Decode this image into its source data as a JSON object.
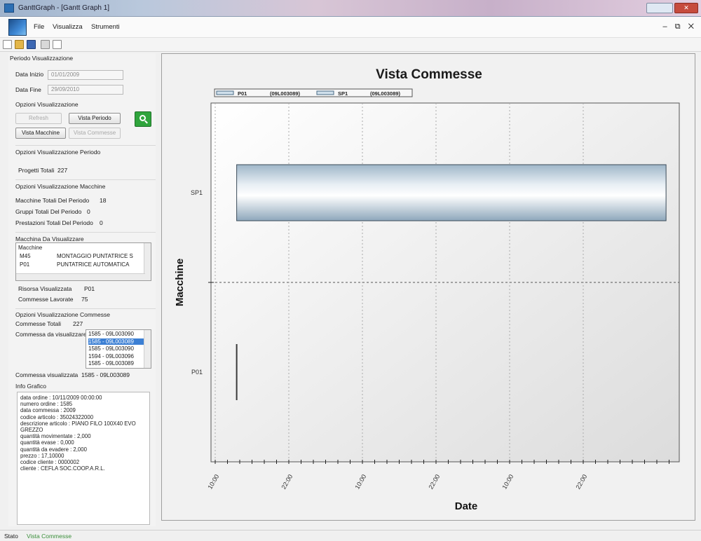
{
  "window": {
    "title": "GanttGraph - [Gantt Graph 1]"
  },
  "menu": [
    "File",
    "Visualizza",
    "Strumenti"
  ],
  "periodo": {
    "header": "Periodo Visualizzazione",
    "data_inizio_label": "Data Inizio",
    "data_inizio_value": "01/01/2009",
    "data_fine_label": "Data Fine",
    "data_fine_value": "29/09/2010"
  },
  "opzioni": {
    "header": "Opzioni Visualizzazione",
    "refresh": "Refresh",
    "vista_periodo": "Vista Periodo",
    "vista_macchine": "Vista Macchine",
    "vista_commesse": "Vista Commesse"
  },
  "periodo_opts": {
    "header": "Opzioni Visualizzazione Periodo",
    "progetti_label": "Progetti Totali",
    "progetti_value": "227"
  },
  "macchine_opts": {
    "header": "Opzioni Visualizzazione Macchine",
    "macchine_totali_label": "Macchine Totali Del Periodo",
    "macchine_totali_value": "18",
    "gruppi_label": "Gruppi Totali Del Periodo",
    "gruppi_value": "0",
    "prestazioni_label": "Prestazioni Totali Del Periodo",
    "prestazioni_value": "0"
  },
  "macchina_da_visualizzare": {
    "header": "Macchina Da Visualizzare",
    "list_header": "Macchine",
    "rows": [
      {
        "code": "M45",
        "desc": "MONTAGGIO PUNTATRICE S"
      },
      {
        "code": "P01",
        "desc": "PUNTATRICE AUTOMATICA"
      }
    ],
    "risorsa_label": "Risorsa Visualizzata",
    "risorsa_value": "P01",
    "commesse_lavorate_label": "Commesse Lavorate",
    "commesse_lavorate_value": "75"
  },
  "commesse_opts": {
    "header": "Opzioni Visualizzazione Commesse",
    "totali_label": "Commesse Totali",
    "totali_value": "227",
    "da_visualizzare_label": "Commessa da visualizzare",
    "list": [
      "1585 - 09L003090",
      "1585 - 09L003089",
      "1585 - 09L003090",
      "1594 - 09L003096",
      "1585 - 09L003089"
    ],
    "selected_index": 1,
    "visualizzata_label": "Commessa visualizzata",
    "visualizzata_value": "1585 - 09L003089"
  },
  "info_grafico": {
    "header": "Info Grafico",
    "lines": [
      "data ordine : 10/11/2009 00:00:00",
      "numero ordine : 1585",
      "data commessa : 2009",
      "codice articolo : 35024322000",
      "descrizione articolo : PIANO FILO 100X40 EVO GREZZO",
      "quantità movimentate : 2,000",
      "quantità evase : 0,000",
      "quantità da evadere : 2,000",
      "prezzo : 17,10000",
      "codice cliente : 0000002",
      "cliente : CEFLA SOC.COOP.A.R.L."
    ]
  },
  "chart_data": {
    "type": "bar",
    "title": "Vista Commesse",
    "xlabel": "Date",
    "ylabel": "Macchine",
    "categories": [
      "P01",
      "SP1"
    ],
    "x_tick_labels": [
      "10:00",
      "22:00",
      "10:00",
      "22:00",
      "10:00",
      "22:00"
    ],
    "legend": [
      {
        "name": "P01",
        "code": "(09L003089)"
      },
      {
        "name": "SP1",
        "code": "(09L003089)"
      }
    ],
    "legend_position": "top-left",
    "x_range_hours": [
      0,
      72
    ],
    "bars": [
      {
        "category": "SP1",
        "start_hours": 3.5,
        "end_hours": 73.5,
        "color": "#c9d9e6"
      },
      {
        "category": "P01",
        "start_hours": 3.5,
        "end_hours": 3.5,
        "color": "#3a3a3a"
      }
    ],
    "grid": true
  },
  "status": {
    "label": "Stato",
    "value": "Vista Commesse",
    "value_color": "#3b8f3b"
  }
}
